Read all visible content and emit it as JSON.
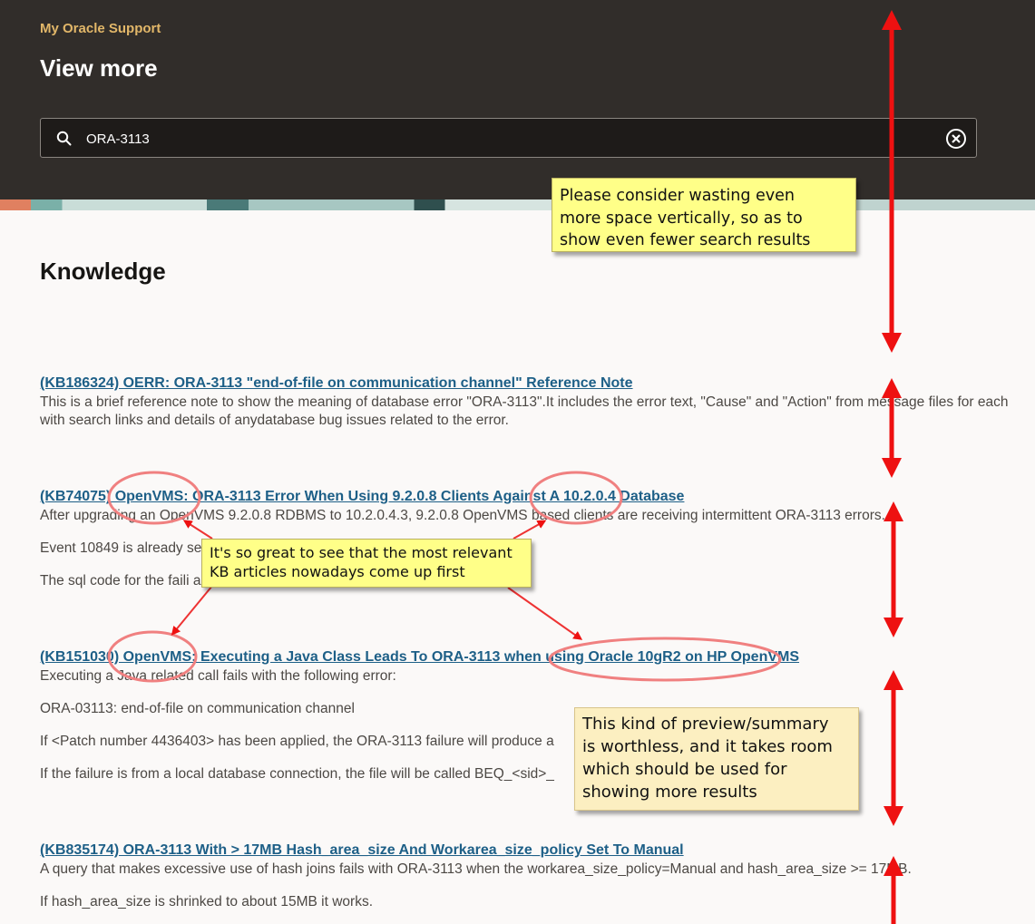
{
  "header": {
    "brand": "My Oracle Support",
    "title": "View more"
  },
  "search": {
    "value": "ORA-3113"
  },
  "section": {
    "title": "Knowledge"
  },
  "results": [
    {
      "title": "(KB186324) OERR: ORA-3113 \"end-of-file on communication channel\" Reference Note",
      "lines": [
        "This is a brief reference note to show the meaning of database error \"ORA-3113\".It includes the error text, \"Cause\" and \"Action\" from message files for each",
        "with search links and details of anydatabase bug issues related to the error."
      ]
    },
    {
      "title": "(KB74075) OpenVMS: ORA-3113 Error When Using 9.2.0.8 Clients Against A 10.2.0.4 Database",
      "lines": [
        "After upgrading an OpenVMS 9.2.0.8 RDBMS to 10.2.0.4.3, 9.2.0.8 OpenVMS based clients are receiving intermittent ORA-3113 errors.",
        "Event 10849 is already se",
        "The sql code for the faili                                                                     acters."
      ]
    },
    {
      "title": "(KB151030) OpenVMS: Executing a Java Class Leads To ORA-3113 when using Oracle 10gR2 on HP OpenVMS",
      "lines": [
        "Executing a Java related call fails with the following error:",
        "ORA-03113: end-of-file on communication channel",
        "If <Patch number 4436403> has been applied, the ORA-3113 failure will produce a",
        "If the failure is from a local database connection, the file will be called BEQ_<sid>_"
      ]
    },
    {
      "title": "(KB835174) ORA-3113 With > 17MB Hash_area_size And Workarea_size_policy Set To Manual",
      "lines": [
        "A query that makes excessive use of hash joins fails with ORA-3113 when the workarea_size_policy=Manual and hash_area_size >= 17MB.",
        "If hash_area_size is shrinked to about 15MB it works."
      ]
    }
  ],
  "annotations": {
    "note1": [
      "Please consider wasting even",
      "more space vertically, so as to",
      "show even fewer search results"
    ],
    "note2": [
      "It's so great to see that the most relevant",
      "KB articles nowadays come up first"
    ],
    "note3": [
      "This kind of preview/summary",
      "is worthless, and it takes room",
      "which should be used for",
      "showing more results"
    ]
  },
  "colors": {
    "header_bg": "#312d2a",
    "brand": "#e2b769",
    "link": "#1d5f87",
    "annotation_arrow": "#ee1111",
    "annotation_circle": "#f08080",
    "note_yellow": "#ffff88",
    "note_tan": "#fcefc1"
  },
  "icons": {
    "search": "search-icon",
    "clear": "clear-circle-x-icon"
  }
}
